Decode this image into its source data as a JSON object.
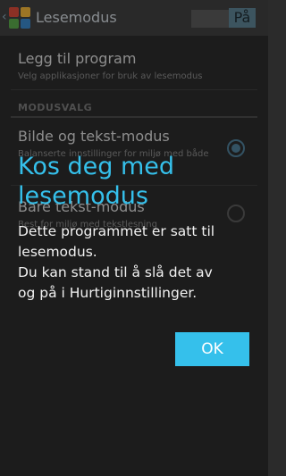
{
  "action_bar": {
    "title": "Lesemodus",
    "switch_label": "På",
    "icons": {
      "back": "back-chevron-icon",
      "app": "lesemodus-app-icon"
    }
  },
  "settings": {
    "add_app": {
      "title": "Legg til program",
      "subtitle": "Velg applikasjoner for bruk av lesemodus"
    },
    "section_header": "MODUSVALG",
    "modes": [
      {
        "title": "Bilde og tekst-modus",
        "subtitle": "Balanserte innstillinger for miljø med både",
        "selected": true
      },
      {
        "title": "Bare tekst-modus",
        "subtitle": "Best for miljø med tekstlesning",
        "selected": false
      }
    ]
  },
  "dialog": {
    "title": "Kos deg med lesemodus",
    "body_lines": [
      "Dette programmet er satt til",
      "lesemodus.",
      "Du kan stand til å slå det av",
      "og på i Hurtiginnstillinger."
    ],
    "ok_label": "OK"
  },
  "colors": {
    "accent": "#35c0eb",
    "background": "#2b2b2b",
    "action_bar": "#404040"
  }
}
